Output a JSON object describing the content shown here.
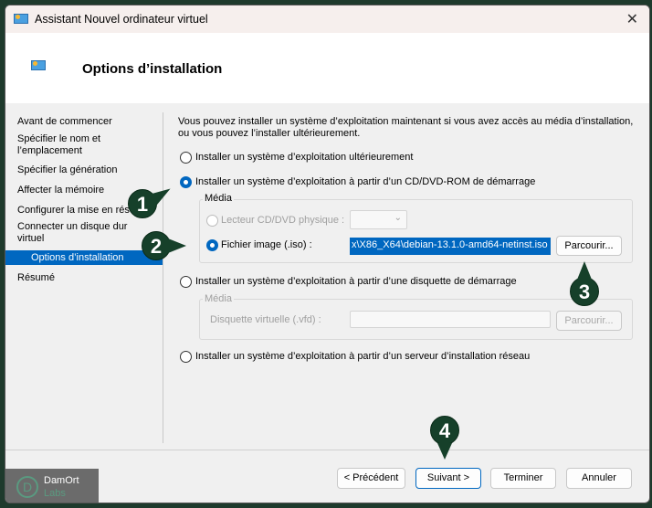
{
  "window": {
    "title": "Assistant Nouvel ordinateur virtuel",
    "close": "✕"
  },
  "header": {
    "title": "Options d’installation"
  },
  "sidebar": {
    "items": [
      {
        "label": "Avant de commencer"
      },
      {
        "label": "Spécifier le nom et l’emplacement"
      },
      {
        "label": "Spécifier la génération"
      },
      {
        "label": "Affecter la mémoire"
      },
      {
        "label": "Configurer la mise en réseau"
      },
      {
        "label": "Connecter un disque dur virtuel"
      },
      {
        "label": "Options d’installation",
        "selected": true
      },
      {
        "label": "Résumé"
      }
    ]
  },
  "main": {
    "intro": "Vous pouvez installer un système d’exploitation maintenant si vous avez accès au média d’installation, ou vous pouvez l’installer ultérieurement.",
    "opt_later": "Installer un système d’exploitation ultérieurement",
    "opt_cd": "Installer un système d’exploitation à partir d’un CD/DVD-ROM de démarrage",
    "media_label": "Média",
    "physical_drive": "Lecteur CD/DVD physique :",
    "image_file": "Fichier image (.iso) :",
    "iso_path": "x\\X86_X64\\debian-13.1.0-amd64-netinst.iso",
    "browse": "Parcourir...",
    "opt_floppy": "Installer un système d’exploitation à partir d’une disquette de démarrage",
    "media_label2": "Média",
    "virtual_floppy": "Disquette virtuelle (.vfd) :",
    "browse2": "Parcourir...",
    "opt_network": "Installer un système d’exploitation à partir d’un serveur d’installation réseau",
    "selected_option": "cd"
  },
  "footer": {
    "prev": "< Précédent",
    "next": "Suivant >",
    "finish": "Terminer",
    "cancel": "Annuler"
  },
  "markers": [
    "1",
    "2",
    "3",
    "4"
  ],
  "watermark": {
    "line1": "DamOrt",
    "line2": "Labs"
  },
  "colors": {
    "accent": "#0067c0",
    "marker": "#16402a",
    "border": "#1e3a2c"
  }
}
